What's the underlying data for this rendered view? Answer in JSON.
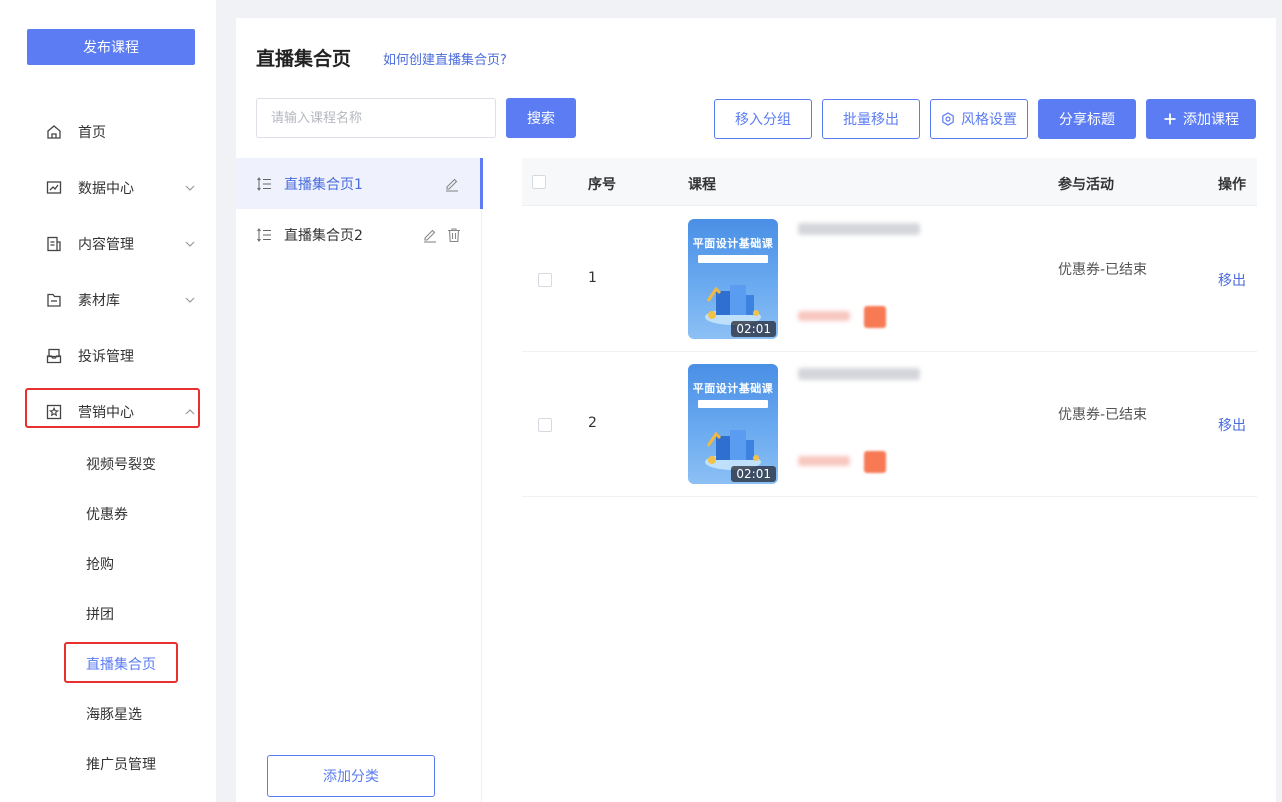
{
  "sidebar": {
    "publish_label": "发布课程",
    "nav": [
      {
        "label": "首页",
        "icon": "home-icon"
      },
      {
        "label": "数据中心",
        "icon": "chart-icon"
      },
      {
        "label": "内容管理",
        "icon": "document-icon"
      },
      {
        "label": "素材库",
        "icon": "folder-icon"
      },
      {
        "label": "投诉管理",
        "icon": "inbox-icon"
      },
      {
        "label": "营销中心",
        "icon": "star-icon"
      }
    ],
    "sub_items": [
      "视频号裂变",
      "优惠券",
      "抢购",
      "拼团",
      "直播集合页",
      "海豚星选",
      "推广员管理"
    ]
  },
  "header": {
    "title": "直播集合页",
    "help_link": "如何创建直播集合页?"
  },
  "search": {
    "placeholder": "请输入课程名称",
    "button": "搜索"
  },
  "toolbar": {
    "move_group": "移入分组",
    "batch_remove": "批量移出",
    "style_settings": "风格设置",
    "share_title": "分享标题",
    "add_course": "添加课程"
  },
  "groups": {
    "items": [
      "直播集合页1",
      "直播集合页2"
    ],
    "add_label": "添加分类"
  },
  "table": {
    "columns": {
      "index": "序号",
      "course": "课程",
      "activity": "参与活动",
      "ops": "操作"
    },
    "rows": [
      {
        "index": "1",
        "thumb_title": "平面设计基础课",
        "duration": "02:01",
        "activity": "优惠券-已结束",
        "op": "移出"
      },
      {
        "index": "2",
        "thumb_title": "平面设计基础课",
        "duration": "02:01",
        "activity": "优惠券-已结束",
        "op": "移出"
      }
    ]
  },
  "colors": {
    "accent": "#5b7cf2",
    "highlight": "#e8312f"
  }
}
